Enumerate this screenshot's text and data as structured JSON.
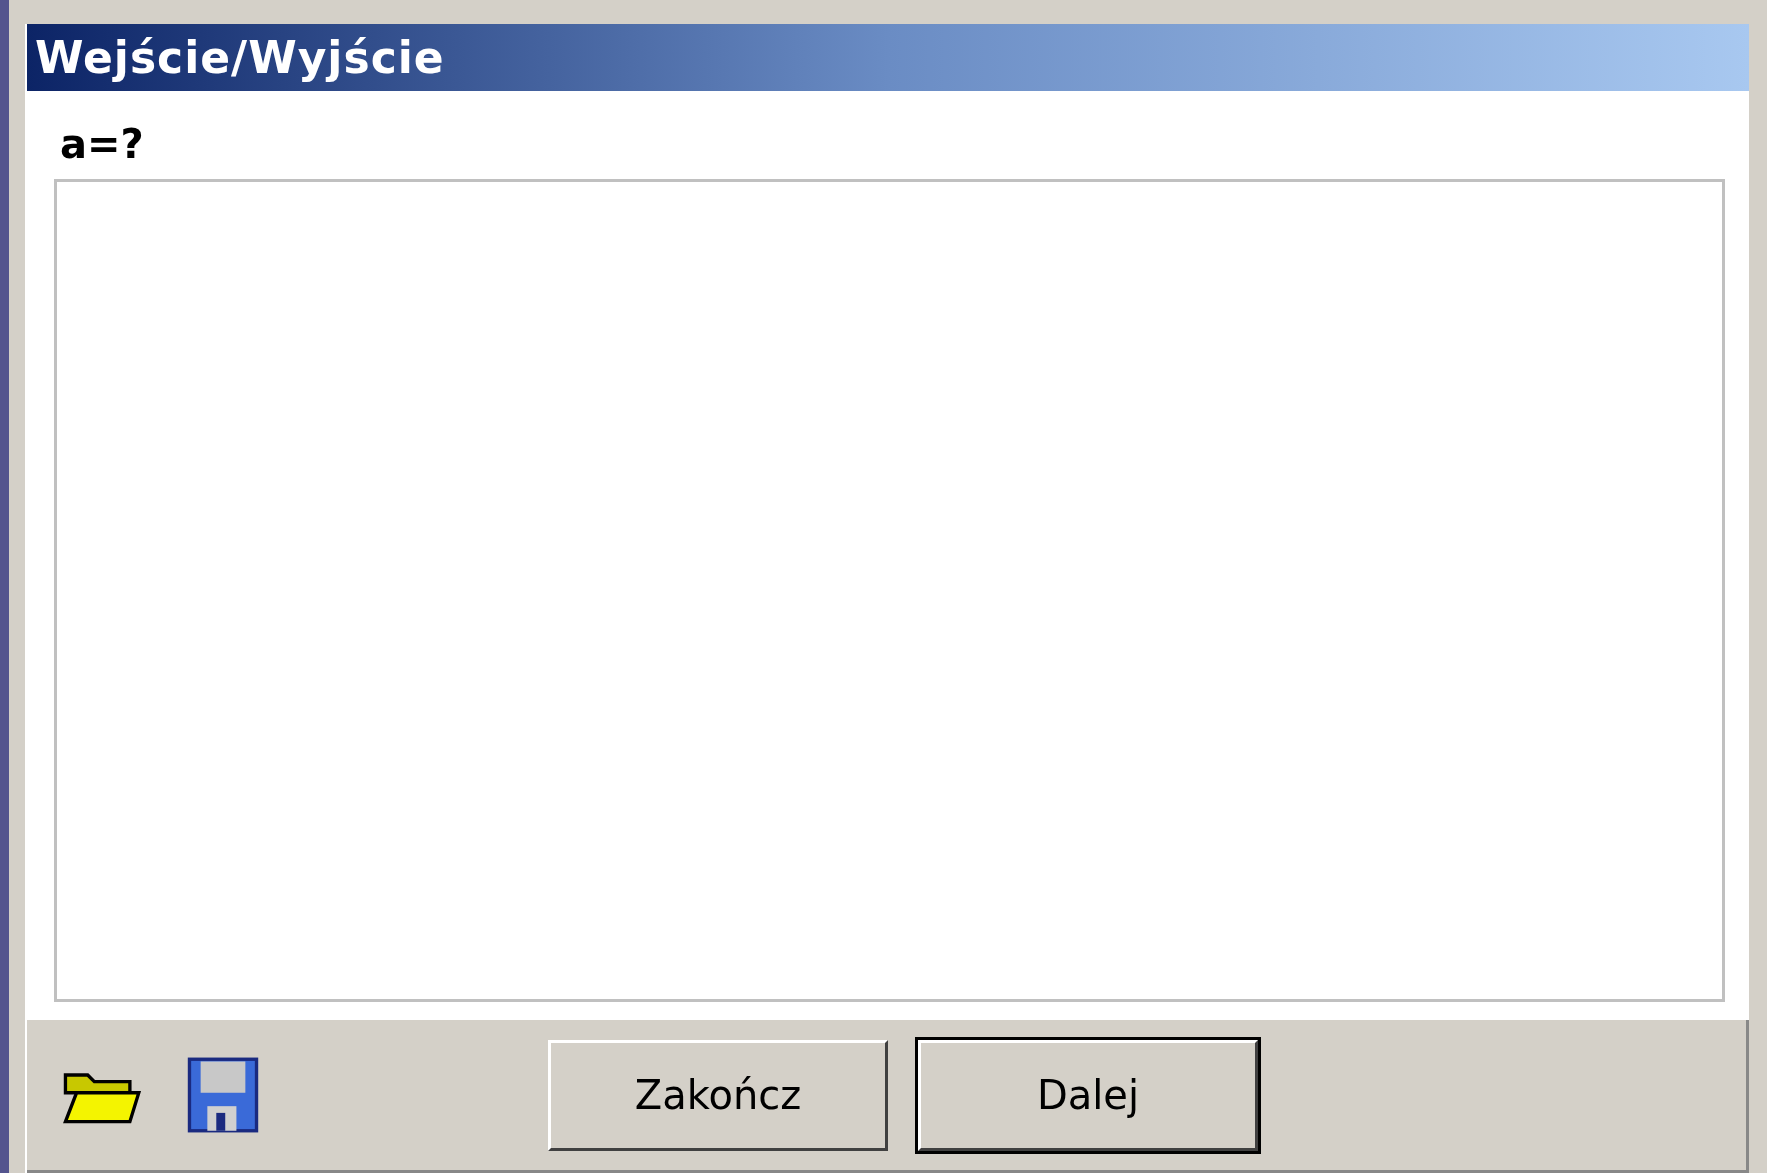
{
  "window": {
    "title": "Wejście/Wyjście"
  },
  "prompt": "a=?",
  "buttons": [
    {
      "label": "Zakończ",
      "default": false
    },
    {
      "label": "Dalej",
      "default": true
    }
  ]
}
